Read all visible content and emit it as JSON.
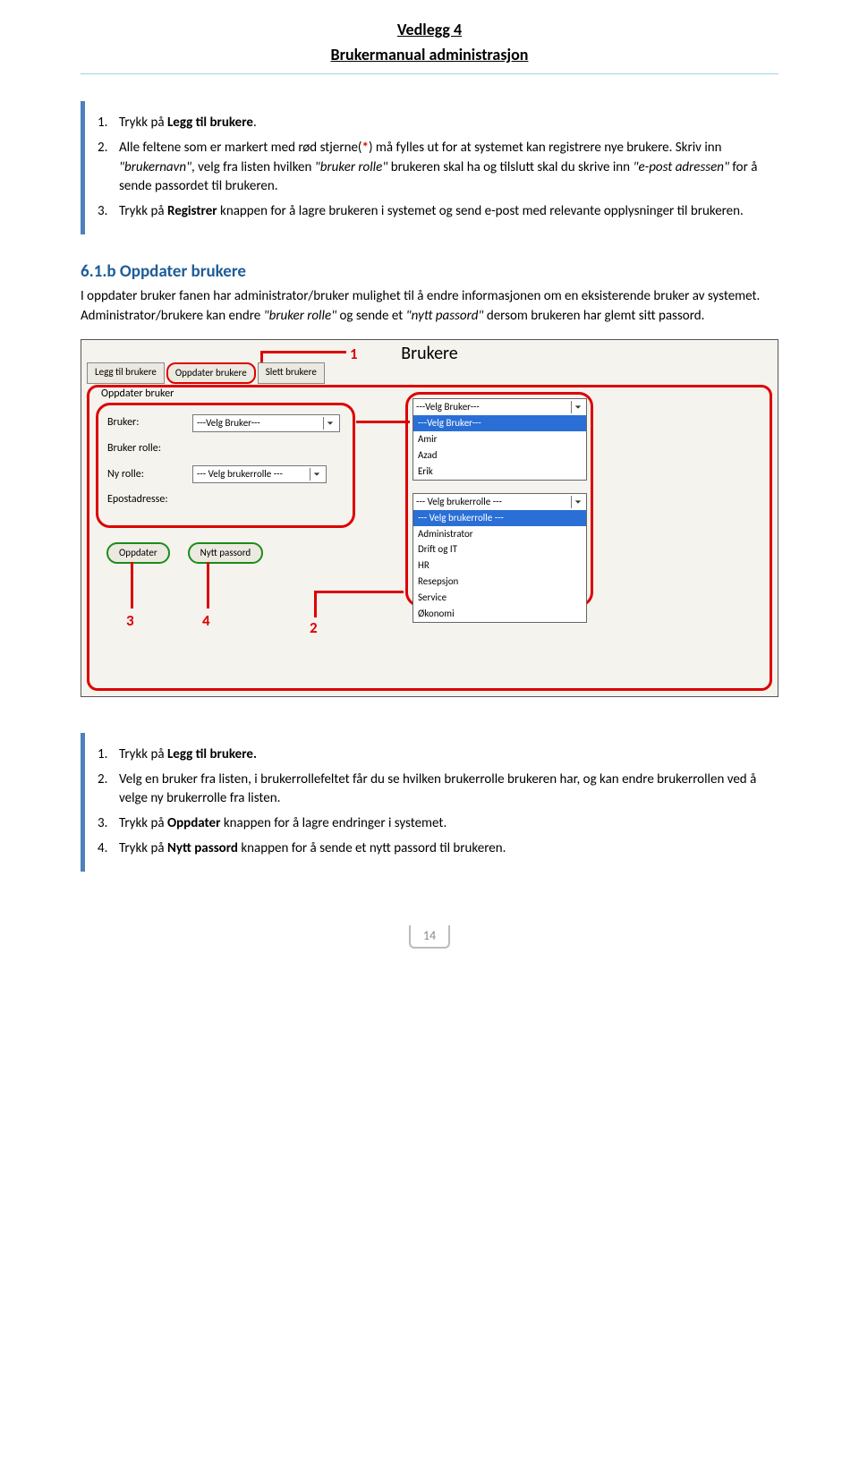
{
  "header": {
    "title": "Vedlegg 4",
    "subtitle": "Brukermanual administrasjon"
  },
  "block1": {
    "items": [
      {
        "num": "1.",
        "prefix": "Trykk på ",
        "bold": "Legg til brukere",
        "suffix": "."
      },
      {
        "num": "2.",
        "text_before_star": "Alle feltene som er markert med rød stjerne(",
        "star": "*",
        "text_after_star": ") må fylles ut for at systemet kan registrere nye brukere. Skriv inn ",
        "i1": "\"brukernavn\"",
        "mid1": ", velg fra listen hvilken ",
        "i2": "\"bruker rolle\"",
        "mid2": " brukeren skal ha og tilslutt skal du skrive inn ",
        "i3": "\"e-post adressen\"",
        "mid3": " for å sende passordet til brukeren."
      },
      {
        "num": "3.",
        "prefix": "Trykk på ",
        "bold": "Registrer",
        "suffix": " knappen for å lagre brukeren i systemet og send e-post med relevante opplysninger til brukeren."
      }
    ]
  },
  "section": {
    "heading": "6.1.b Oppdater brukere",
    "body_a": "I oppdater bruker fanen har administrator/bruker mulighet til å endre informasjonen om en eksisterende bruker av systemet. Administrator/brukere kan endre ",
    "i1": "\"bruker rolle\"",
    "mid": " og sende et ",
    "i2": "\"nytt passord\"",
    "body_b": " dersom brukeren har glemt sitt passord."
  },
  "ui": {
    "title": "Brukere",
    "tabs": [
      "Legg til brukere",
      "Oppdater brukere",
      "Slett brukere"
    ],
    "fieldset_title": "Oppdater bruker",
    "labels": {
      "bruker": "Bruker:",
      "bruker_rolle": "Bruker rolle:",
      "ny_rolle": "Ny rolle:",
      "epost": "Epostadresse:"
    },
    "select_bruker": "---Velg Bruker---",
    "select_rolle": "--- Velg brukerrolle ---",
    "bruker_options": [
      "---Velg Bruker---",
      "---Velg Bruker---",
      "Amir",
      "Azad",
      "Erik"
    ],
    "rolle_options": [
      "--- Velg brukerrolle ---",
      "--- Velg brukerrolle ---",
      "Administrator",
      "Drift og IT",
      "HR",
      "Resepsjon",
      "Service",
      "Økonomi"
    ],
    "buttons": {
      "oppdater": "Oppdater",
      "nytt_passord": "Nytt passord"
    },
    "callouts": {
      "c1": "1",
      "c2": "2",
      "c3": "3",
      "c4": "4"
    }
  },
  "block2": {
    "items": [
      {
        "num": "1.",
        "prefix": "Trykk på ",
        "bold": "Legg til brukere.",
        "suffix": ""
      },
      {
        "num": "2.",
        "text": "Velg en bruker fra listen, i brukerrollefeltet får du se hvilken brukerrolle brukeren har, og kan endre brukerrollen ved å velge ny brukerrolle fra listen."
      },
      {
        "num": "3.",
        "prefix": "Trykk på ",
        "bold": "Oppdater",
        "suffix": " knappen for å lagre endringer i systemet."
      },
      {
        "num": "4.",
        "prefix": " Trykk på ",
        "bold": "Nytt passord",
        "suffix": " knappen for å sende et nytt passord til brukeren."
      }
    ]
  },
  "footer": {
    "page_number": "14"
  }
}
